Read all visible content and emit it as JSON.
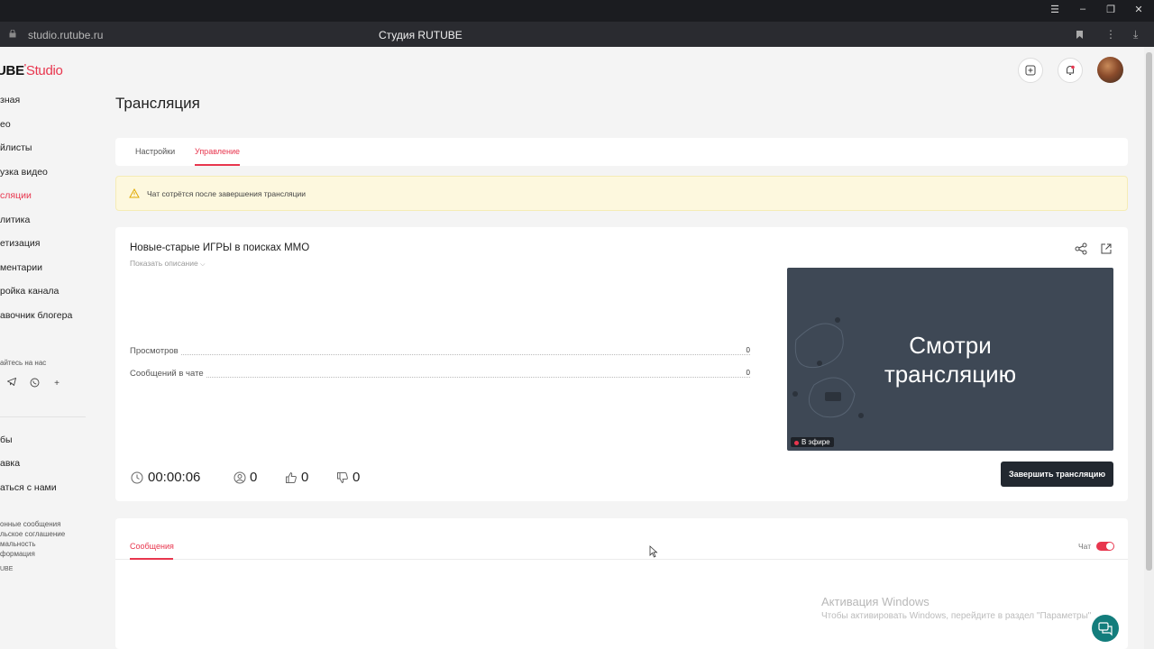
{
  "browser": {
    "url": "studio.rutube.ru",
    "page_title": "Студия RUTUBE"
  },
  "sidebar": {
    "logo_main": "UBE",
    "logo_studio": "Studio",
    "items": [
      {
        "label": "зная"
      },
      {
        "label": "ео"
      },
      {
        "label": "йлисты"
      },
      {
        "label": "узка видео"
      },
      {
        "label": "сляции"
      },
      {
        "label": "литика"
      },
      {
        "label": "етизация"
      },
      {
        "label": "ментарии"
      },
      {
        "label": "ройка канала"
      },
      {
        "label": "авочник блогера"
      }
    ],
    "social_title": "айтесь на нас",
    "secondary_items": [
      {
        "label": "бы"
      },
      {
        "label": "авка"
      },
      {
        "label": "аться с нами"
      }
    ],
    "footer_links": [
      {
        "label": "онные сообщения"
      },
      {
        "label": "льское соглашение"
      },
      {
        "label": "мальность"
      },
      {
        "label": "формация"
      }
    ],
    "copyright": "UBE"
  },
  "page": {
    "title": "Трансляция"
  },
  "tabs": [
    {
      "label": "Настройки"
    },
    {
      "label": "Управление"
    }
  ],
  "alert": {
    "text": "Чат сотрётся после завершения трансляции"
  },
  "stream": {
    "title": "Новые-старые ИГРЫ в поисках ММО",
    "show_description": "Показать описание",
    "stats": [
      {
        "label": "Просмотров",
        "value": "0"
      },
      {
        "label": "Сообщений в чате",
        "value": "0"
      }
    ],
    "duration": "00:00:06",
    "viewers": "0",
    "likes": "0",
    "dislikes": "0",
    "preview_cta_line1": "Смотри",
    "preview_cta_line2": "трансляцию",
    "live_badge": "В эфире",
    "end_button": "Завершить трансляцию"
  },
  "chat": {
    "tab_label": "Сообщения",
    "toggle_label": "Чат",
    "toggle_on": true
  },
  "watermark": {
    "line1": "Активация Windows",
    "line2": "Чтобы активировать Windows, перейдите в раздел \"Параметры\""
  },
  "colors": {
    "accent": "#e8364e",
    "dark_button": "#222830",
    "preview_bg": "#3e4855",
    "help_fab": "#137d7c"
  }
}
